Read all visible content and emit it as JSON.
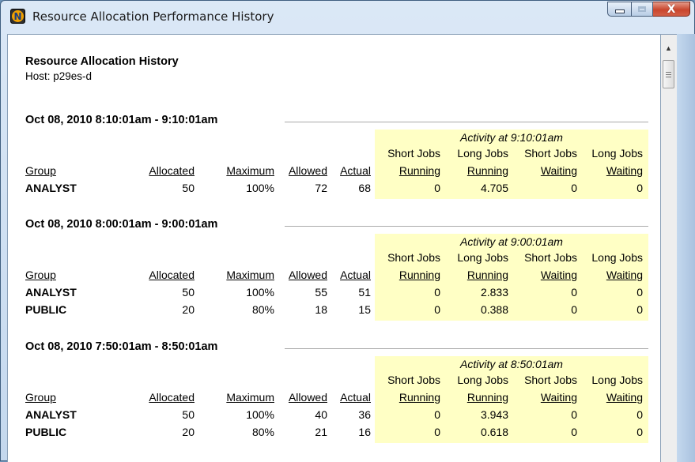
{
  "window": {
    "title": "Resource Allocation Performance History",
    "app_icon_letter": "N"
  },
  "report": {
    "title": "Resource Allocation History",
    "host": "Host: p29es-d"
  },
  "columns": {
    "group": "Group",
    "allocated": "Allocated",
    "maximum": "Maximum",
    "allowed": "Allowed",
    "actual": "Actual",
    "short_top": "Short Jobs",
    "long_top": "Long Jobs",
    "running": "Running",
    "waiting": "Waiting"
  },
  "sections": [
    {
      "period": "Oct 08, 2010 8:10:01am - 9:10:01am",
      "activity_label": "Activity at 9:10:01am",
      "rows": [
        {
          "group": "ANALYST",
          "allocated": "50",
          "maximum": "100%",
          "allowed": "72",
          "actual": "68",
          "short_running": "0",
          "long_running": "4.705",
          "short_waiting": "0",
          "long_waiting": "0"
        }
      ]
    },
    {
      "period": "Oct 08, 2010 8:00:01am - 9:00:01am",
      "activity_label": "Activity at 9:00:01am",
      "rows": [
        {
          "group": "ANALYST",
          "allocated": "50",
          "maximum": "100%",
          "allowed": "55",
          "actual": "51",
          "short_running": "0",
          "long_running": "2.833",
          "short_waiting": "0",
          "long_waiting": "0"
        },
        {
          "group": "PUBLIC",
          "allocated": "20",
          "maximum": "80%",
          "allowed": "18",
          "actual": "15",
          "short_running": "0",
          "long_running": "0.388",
          "short_waiting": "0",
          "long_waiting": "0"
        }
      ]
    },
    {
      "period": "Oct 08, 2010 7:50:01am - 8:50:01am",
      "activity_label": "Activity at 8:50:01am",
      "rows": [
        {
          "group": "ANALYST",
          "allocated": "50",
          "maximum": "100%",
          "allowed": "40",
          "actual": "36",
          "short_running": "0",
          "long_running": "3.943",
          "short_waiting": "0",
          "long_waiting": "0"
        },
        {
          "group": "PUBLIC",
          "allocated": "20",
          "maximum": "80%",
          "allowed": "21",
          "actual": "16",
          "short_running": "0",
          "long_running": "0.618",
          "short_waiting": "0",
          "long_waiting": "0"
        }
      ]
    }
  ],
  "colors": {
    "activity_highlight": "#ffffc5",
    "close_button": "#c9462d"
  },
  "icons": [
    "minimize-icon",
    "maximize-icon",
    "close-icon",
    "scroll-up-arrow-icon",
    "scroll-grip-icon"
  ]
}
